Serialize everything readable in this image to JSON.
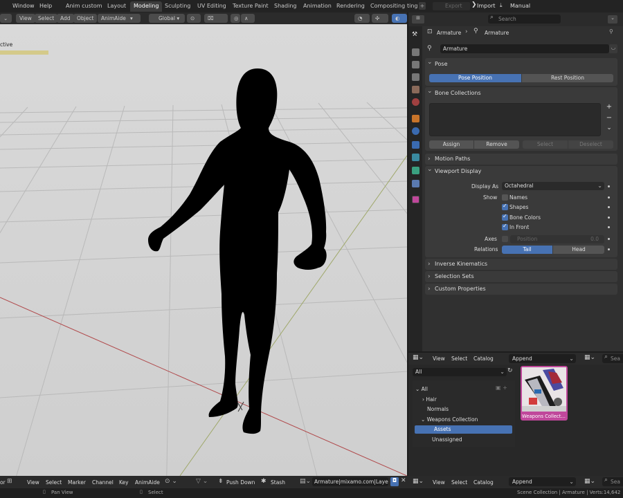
{
  "menu": [
    "ctive",
    "Window",
    "Help"
  ],
  "workspaces": [
    "Anim custom",
    "Layout",
    "Modeling",
    "Sculpting",
    "UV Editing",
    "Texture Paint",
    "Shading",
    "Animation",
    "Rendering",
    "Compositing",
    "ting"
  ],
  "top_right": {
    "export": "Export",
    "import": "Import",
    "manual": "Manual"
  },
  "viewport_header": {
    "view": "View",
    "select": "Select",
    "add": "Add",
    "object": "Object",
    "animaide": "AnimAide",
    "orientation": "Global"
  },
  "viewport_overlay_text": "ctive",
  "search_placeholder": "Search",
  "breadcrumb": {
    "left": "Armature",
    "right": "Armature"
  },
  "object_name": "Armature",
  "pose": {
    "header": "Pose",
    "pose_position": "Pose Position",
    "rest_position": "Rest Position"
  },
  "bone_collections": {
    "header": "Bone Collections",
    "assign": "Assign",
    "remove": "Remove",
    "select": "Select",
    "deselect": "Deselect"
  },
  "motion_paths": "Motion Paths",
  "viewport_display": {
    "header": "Viewport Display",
    "display_as_label": "Display As",
    "display_as_value": "Octahedral",
    "show_label": "Show",
    "names": "Names",
    "shapes": "Shapes",
    "bone_colors": "Bone Colors",
    "in_front": "In Front",
    "axes_label": "Axes",
    "position": "Position",
    "position_value": "0.0",
    "relations_label": "Relations",
    "tail": "Tail",
    "head": "Head"
  },
  "collapsed_panels": [
    "Inverse Kinematics",
    "Selection Sets",
    "Custom Properties"
  ],
  "asset_browser": {
    "view": "View",
    "select": "Select",
    "catalog": "Catalog",
    "append": "Append",
    "search": "Sea",
    "filter": "All",
    "tree": [
      "All",
      "Hair",
      "Normals",
      "Weapons Collection",
      "Assets",
      "Unassigned"
    ],
    "asset_label": "Weapons Collect..."
  },
  "bottom_bar": {
    "view": "View",
    "select": "Select",
    "marker": "Marker",
    "channel": "Channel",
    "key": "Key",
    "animaide": "AnimAide",
    "push_down": "Push Down",
    "stash": "Stash",
    "action": "Armature|mixamo.com|Layer0",
    "editor": "or"
  },
  "bottom_right": {
    "view": "View",
    "select": "Select",
    "catalog": "Catalog",
    "append": "Append",
    "search": "Sea"
  },
  "status": {
    "pan": "Pan View",
    "select": "Select",
    "info": "Scene Collection | Armature | Verts:14,642"
  },
  "colors": {
    "accent": "#4772b3",
    "asset_border": "#c0479b",
    "grid_red": "#b0484a"
  }
}
